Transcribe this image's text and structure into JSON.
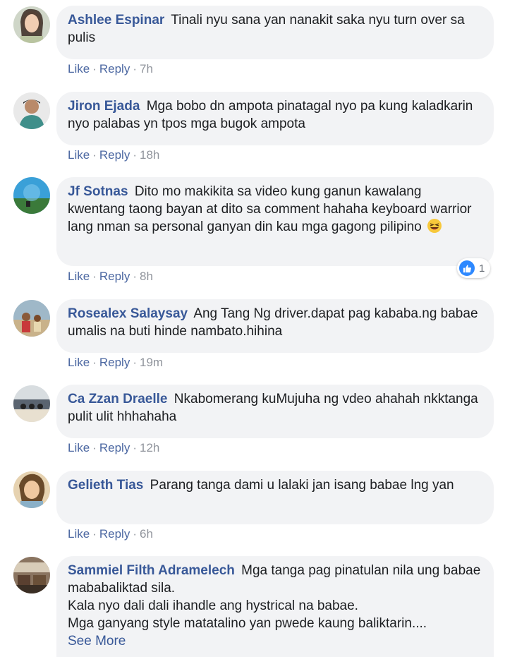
{
  "colors": {
    "bubble_bg": "#f2f3f5",
    "author": "#385898",
    "action_link": "#4b67a1",
    "meta": "#90949c",
    "like_badge": "#2d88ff"
  },
  "action_labels": {
    "like": "Like",
    "reply": "Reply"
  },
  "comments": [
    {
      "author": "Ashlee Espinar",
      "text": "Tinali nyu sana yan nanakit saka nyu turn over sa pulis",
      "time": "7h"
    },
    {
      "author": "Jiron Ejada",
      "text": "Mga bobo dn ampota pinatagal nyo pa kung kaladkarin nyo palabas yn tpos mga bugok ampota",
      "time": "18h"
    },
    {
      "author": "Jf Sotnas",
      "text": "Dito mo makikita sa video kung ganun kawalang kwentang taong bayan at dito sa comment hahaha keyboard warrior lang nman sa personal ganyan din kau mga gagong pilipino",
      "emoji": "laughing-emoji",
      "time": "8h",
      "reaction": {
        "icon": "thumbs-up-icon",
        "count": "1"
      }
    },
    {
      "author": "Rosealex Salaysay",
      "text": "Ang Tang Ng driver.dapat pag kababa.ng babae umalis na buti hinde nambato.hihina",
      "time": "19m"
    },
    {
      "author": "Ca Zzan Draelle",
      "text": "Nkabomerang kuMujuha ng vdeo ahahah nkktanga pulit ulit hhhahaha",
      "time": "12h"
    },
    {
      "author": "Gelieth Tias",
      "text": "Parang tanga dami u lalaki jan isang babae lng yan",
      "time": "6h"
    },
    {
      "author": "Sammiel Filth Adramelech",
      "text": "Mga tanga pag pinatulan nila ung babae mababaliktad sila.",
      "text_line2": "Kala nyo dali dali ihandle ang hystrical na babae.",
      "text_line3": "Mga ganyang style matatalino yan pwede kaung baliktarin....",
      "see_more": "See More"
    }
  ]
}
